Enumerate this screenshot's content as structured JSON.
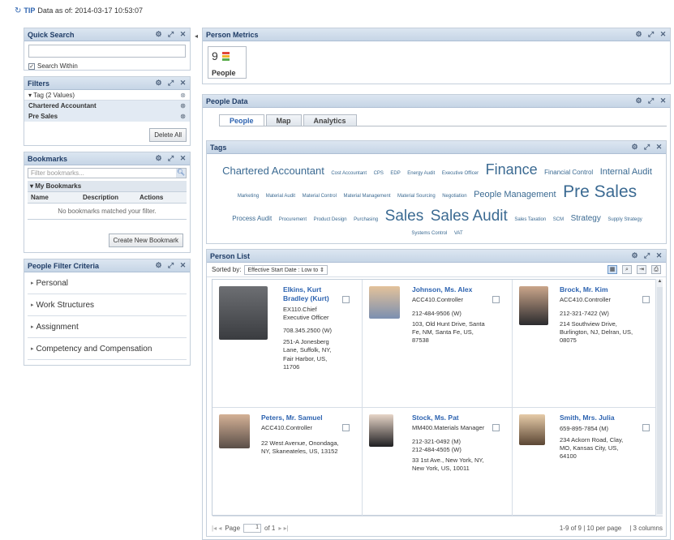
{
  "topbar": {
    "tip": "TIP",
    "text": "Data as of: 2014-03-17 10:53:07"
  },
  "colors": {
    "header": "#c6d5e6",
    "link": "#2d63b0",
    "tag": "#3b6a92"
  },
  "quick_search": {
    "title": "Quick Search",
    "input_value": "",
    "search_within_label": "Search Within"
  },
  "filters": {
    "title": "Filters",
    "tag_label": "Tag (2 Values)",
    "values": [
      "Chartered Accountant",
      "Pre Sales"
    ],
    "delete_all_label": "Delete All"
  },
  "bookmarks": {
    "title": "Bookmarks",
    "filter_placeholder": "Filter bookmarks...",
    "group_label": "My Bookmarks",
    "columns": [
      "Name",
      "Description",
      "Actions"
    ],
    "empty_message": "No bookmarks matched your filter.",
    "create_label": "Create New Bookmark"
  },
  "people_filter": {
    "title": "People Filter Criteria",
    "items": [
      "Personal",
      "Work Structures",
      "Assignment",
      "Competency and Compensation"
    ]
  },
  "person_metrics": {
    "title": "Person Metrics",
    "count": "9",
    "label": "People"
  },
  "people_data": {
    "title": "People Data",
    "tabs": [
      "People",
      "Map",
      "Analytics"
    ]
  },
  "tags": {
    "title": "Tags",
    "items": [
      {
        "text": "Chartered Accountant",
        "size": 13
      },
      {
        "text": "Cost Accountant",
        "size": 6
      },
      {
        "text": "CPS",
        "size": 6
      },
      {
        "text": "EDP",
        "size": 6
      },
      {
        "text": "Energy Audit",
        "size": 6
      },
      {
        "text": "Executive Officer",
        "size": 6
      },
      {
        "text": "Finance",
        "size": 18
      },
      {
        "text": "Financial Control",
        "size": 8
      },
      {
        "text": "Internal Audit",
        "size": 11
      },
      {
        "text": "Marketing",
        "size": 6
      },
      {
        "text": "Material Audit",
        "size": 6
      },
      {
        "text": "Material Control",
        "size": 6
      },
      {
        "text": "Material Management",
        "size": 6
      },
      {
        "text": "Material Sourcing",
        "size": 6
      },
      {
        "text": "Negotiation",
        "size": 6
      },
      {
        "text": "People Management",
        "size": 11
      },
      {
        "text": "Pre Sales",
        "size": 21
      },
      {
        "text": "Process Audit",
        "size": 8
      },
      {
        "text": "Procurement",
        "size": 6
      },
      {
        "text": "Product Design",
        "size": 6
      },
      {
        "text": "Purchasing",
        "size": 6
      },
      {
        "text": "Sales",
        "size": 19
      },
      {
        "text": "Sales Audit",
        "size": 19
      },
      {
        "text": "Sales Taxation",
        "size": 6
      },
      {
        "text": "SCM",
        "size": 6
      },
      {
        "text": "Strategy",
        "size": 10
      },
      {
        "text": "Supply Strategy",
        "size": 6
      },
      {
        "text": "Systems Control",
        "size": 6
      },
      {
        "text": "VAT",
        "size": 6
      }
    ]
  },
  "person_list": {
    "title": "Person List",
    "sorted_by_label": "Sorted by:",
    "sort_value": "Effective Start Date : Low to ⇕",
    "people": [
      {
        "name": "Elkins, Kurt Bradley (Kurt)",
        "title": "EX110.Chief Executive Officer",
        "phone": "708.345.2500 (W)",
        "address": "251-A Jonesberg Lane, Suffolk, NY, Fair Harbor, US, 11706"
      },
      {
        "name": "Johnson, Ms. Alex",
        "title": "ACC410.Controller",
        "phone": "212-484-9506 (W)",
        "address": "103, Old Hunt Drive, Santa Fe, NM, Santa Fe, US, 87538"
      },
      {
        "name": "Brock, Mr. Kim",
        "title": "ACC410.Controller",
        "phone": "212-321-7422 (W)",
        "address": "214 Southview Drive, Burlington, NJ, Delran, US, 08075"
      },
      {
        "name": "Peters, Mr. Samuel",
        "title": "ACC410.Controller",
        "phone": "",
        "address": "22 West Avenue, Onondaga, NY, Skaneateles, US, 13152"
      },
      {
        "name": "Stock, Ms. Pat",
        "title": "MM400.Materials Manager",
        "phone": "212-321-0492 (M)\n212-484-4505 (W)",
        "address": "33 1st Ave., New York, NY, New York, US, 10011"
      },
      {
        "name": "Smith, Mrs. Julia",
        "title": "",
        "phone": "659-895-7854 (M)",
        "address": "234 Ackorn Road, Clay, MO, Kansas City, US, 64100"
      }
    ],
    "pager": {
      "page_label": "Page",
      "page_value": "1",
      "of_label": "of 1",
      "summary": "1-9 of 9 | 10 per page",
      "columns_label": "| 3 columns"
    }
  }
}
